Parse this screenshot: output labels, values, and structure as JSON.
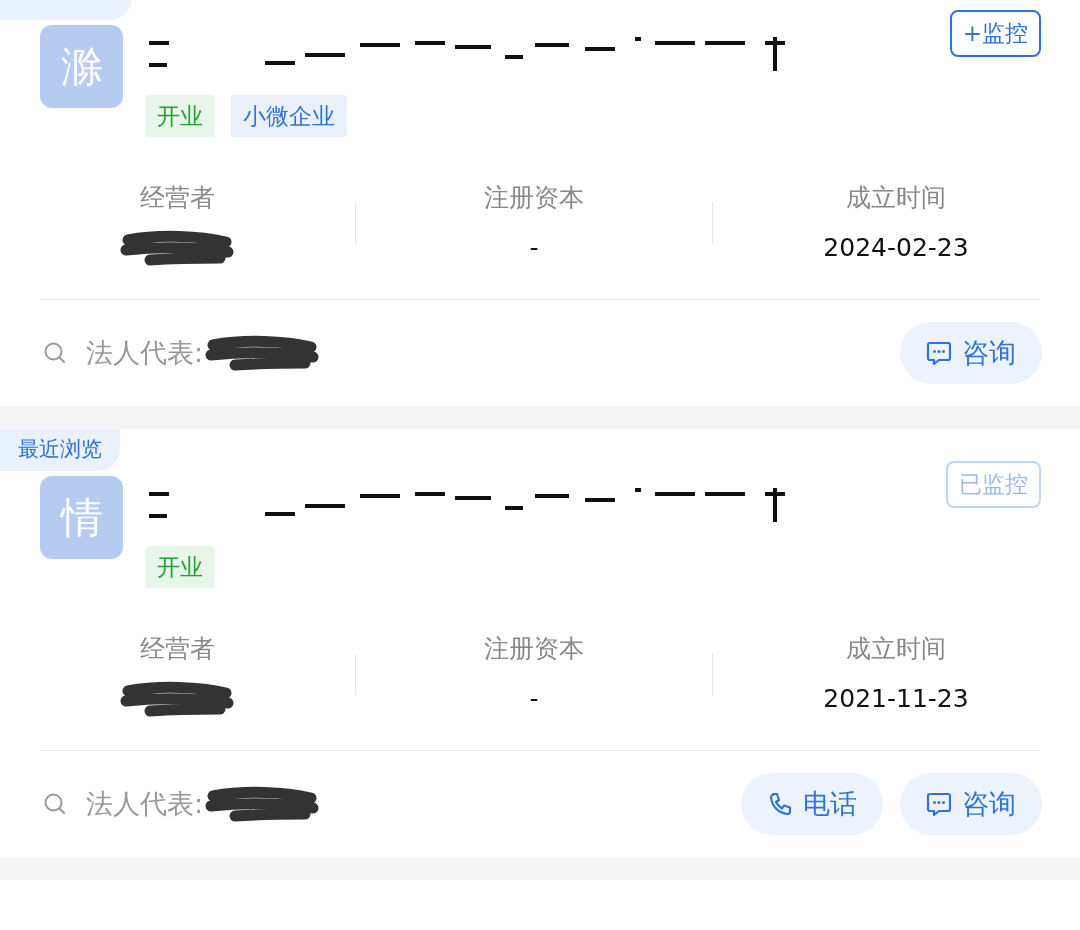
{
  "cards": [
    {
      "logo_char": "滁",
      "tags": [
        {
          "label": "开业",
          "color": "#22a033"
        },
        {
          "label": "小微企业",
          "color": "#2f73d6"
        }
      ],
      "monitor_button": {
        "label": "+监控",
        "monitored": false
      },
      "stats": [
        {
          "label": "经营者"
        },
        {
          "label": "注册资本",
          "value": "-"
        },
        {
          "label": "成立时间",
          "value": "2024-02-23"
        }
      ],
      "legal_rep_label": "法人代表:",
      "actions": [
        {
          "kind": "consult",
          "label": "咨询"
        }
      ]
    },
    {
      "badge": "最近浏览",
      "logo_char": "情",
      "tags": [
        {
          "label": "开业",
          "color": "#22a033"
        }
      ],
      "monitor_button": {
        "label": "已监控",
        "monitored": true
      },
      "stats": [
        {
          "label": "经营者"
        },
        {
          "label": "注册资本",
          "value": "-"
        },
        {
          "label": "成立时间",
          "value": "2021-11-23"
        }
      ],
      "legal_rep_label": "法人代表:",
      "actions": [
        {
          "kind": "phone",
          "label": "电话"
        },
        {
          "kind": "consult",
          "label": "咨询"
        }
      ]
    }
  ]
}
